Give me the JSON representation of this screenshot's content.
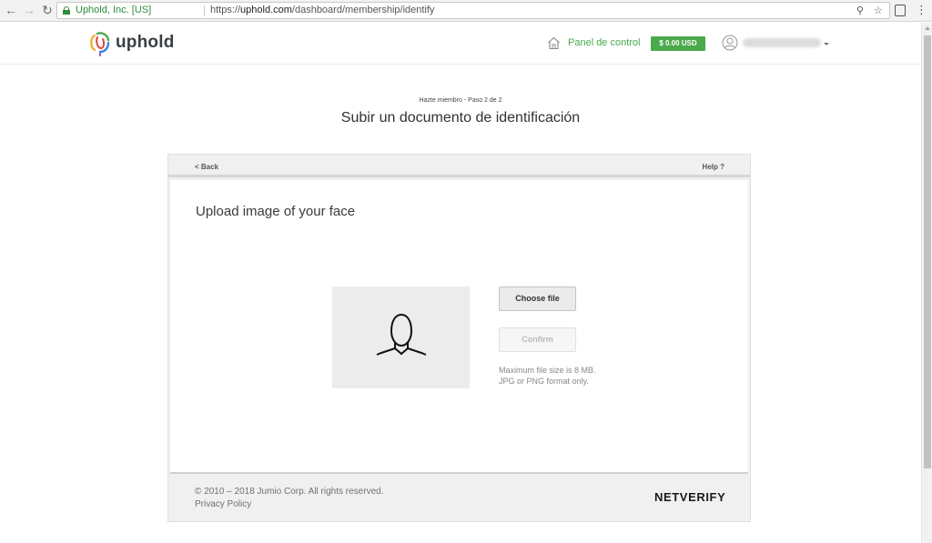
{
  "browser": {
    "back_icon": "back-arrow-icon",
    "forward_icon": "forward-arrow-icon",
    "reload_icon": "reload-icon",
    "origin_label": "Uphold, Inc. [US]",
    "url_scheme": "https://",
    "url_host": "uphold.com",
    "url_path": "/dashboard/membership/identify",
    "colors": {
      "secure": "#2e8b3a"
    }
  },
  "header": {
    "logo_text": "uphold",
    "dashboard_label": "Panel de control",
    "balance": "$ 0.00 USD",
    "colors": {
      "accent": "#49a94b"
    }
  },
  "membership": {
    "step": "Hazte miembro - Paso 2 de 2",
    "title": "Subir un documento de identificación"
  },
  "verify": {
    "back_label": "< Back",
    "help_label": "Help ?",
    "upload_title": "Upload image of your face",
    "choose_file_label": "Choose file",
    "confirm_label": "Confirm",
    "hint_size": "Maximum file size is 8 MB.",
    "hint_format": "JPG or PNG format only.",
    "copyright": "© 2010 – 2018 Jumio Corp. All rights reserved.",
    "privacy_label": "Privacy Policy",
    "brand": "NETVERIFY"
  }
}
